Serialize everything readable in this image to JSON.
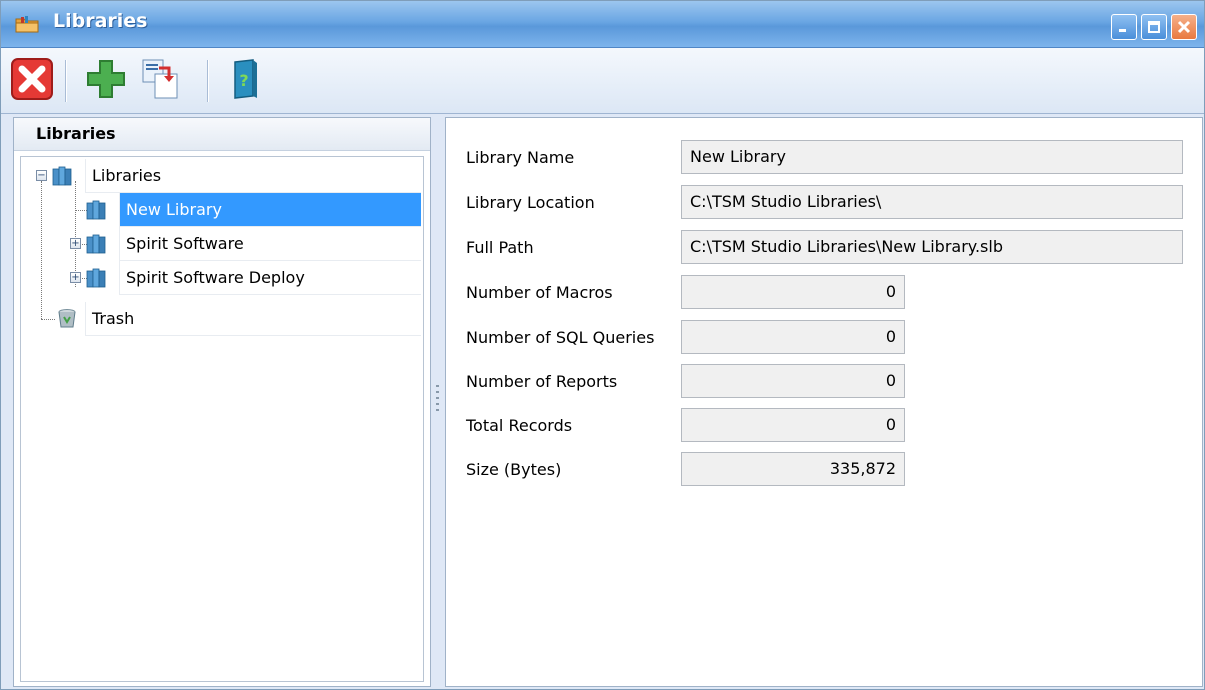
{
  "window": {
    "title": "Libraries"
  },
  "toolbar": {
    "buttons": [
      {
        "name": "delete",
        "icon": "red-x-icon"
      },
      {
        "name": "add",
        "icon": "green-plus-icon"
      },
      {
        "name": "copy",
        "icon": "copy-document-icon"
      },
      {
        "name": "help",
        "icon": "help-book-icon"
      }
    ]
  },
  "left_pane": {
    "header": "Libraries",
    "tree": {
      "root": {
        "label": "Libraries",
        "expanded": true
      },
      "children": [
        {
          "label": "New Library",
          "selected": true,
          "expandable": false
        },
        {
          "label": "Spirit Software",
          "selected": false,
          "expandable": true
        },
        {
          "label": "Spirit Software Deploy",
          "selected": false,
          "expandable": true
        }
      ],
      "trash": {
        "label": "Trash"
      }
    }
  },
  "details": {
    "library_name": {
      "label": "Library Name",
      "value": "New Library"
    },
    "library_location": {
      "label": "Library Location",
      "value": "C:\\TSM Studio Libraries\\"
    },
    "full_path": {
      "label": "Full Path",
      "value": "C:\\TSM Studio Libraries\\New Library.slb"
    },
    "macros": {
      "label": "Number of Macros",
      "value": "0"
    },
    "sql_queries": {
      "label": "Number of SQL Queries",
      "value": "0"
    },
    "reports": {
      "label": "Number of Reports",
      "value": "0"
    },
    "total_records": {
      "label": "Total Records",
      "value": "0"
    },
    "size": {
      "label": "Size (Bytes)",
      "value": "335,872"
    }
  },
  "colors": {
    "title_bar": "#5a98da",
    "selection": "#3399ff",
    "field_background": "#f0f0f0"
  }
}
